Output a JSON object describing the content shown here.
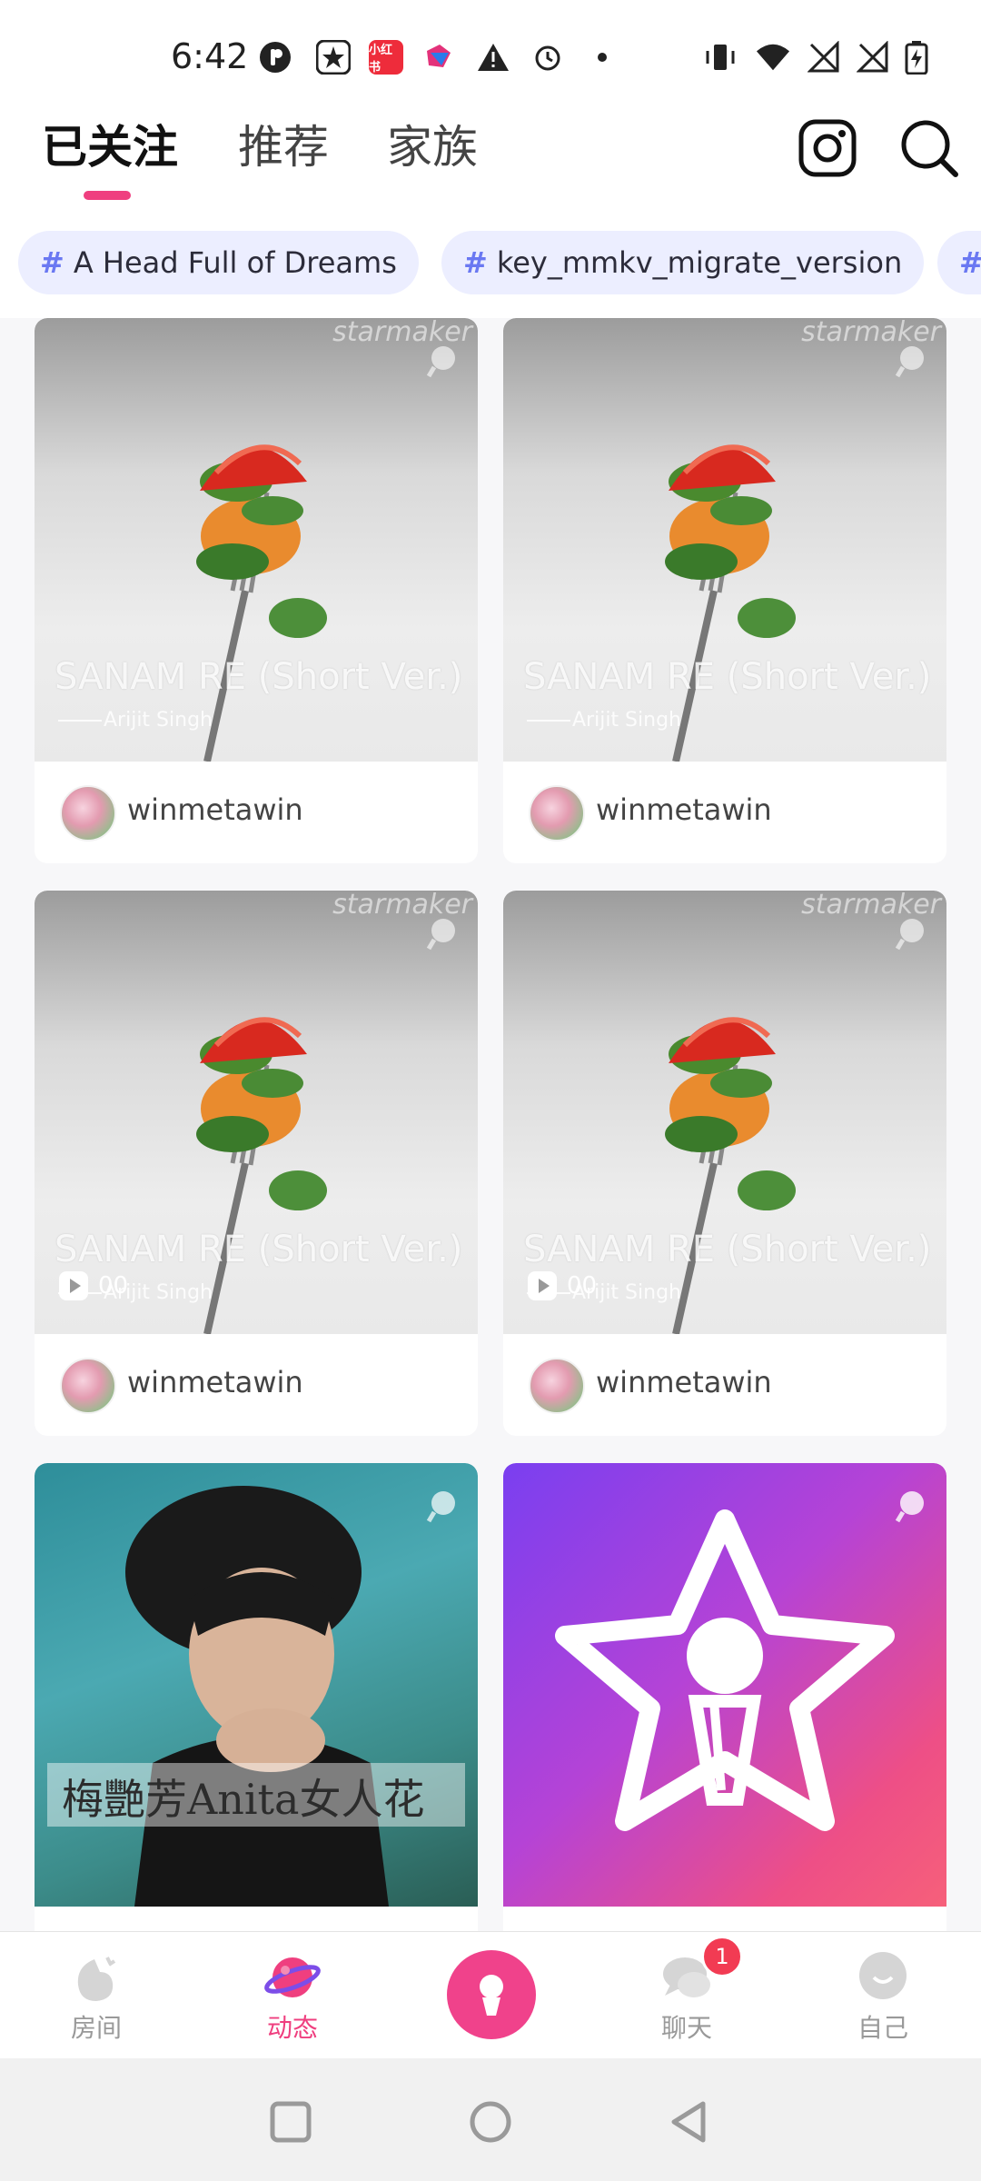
{
  "status_bar": {
    "time": "6:42",
    "left_icons": [
      "p-app-icon",
      "star-app-icon",
      "xiaohongshu-app-icon",
      "bilibili-app-icon",
      "warning-icon",
      "alarm-icon",
      "dot-icon"
    ],
    "xiaohongshu_label": "小红书",
    "right_icons": [
      "vibrate-icon",
      "wifi-icon",
      "no-signal-icon",
      "no-signal-icon",
      "battery-charging-icon"
    ]
  },
  "top_nav": {
    "tabs": [
      {
        "label": "已关注",
        "active": true
      },
      {
        "label": "推荐",
        "active": false
      },
      {
        "label": "家族",
        "active": false
      }
    ],
    "actions": [
      "instagram-icon",
      "search-icon"
    ]
  },
  "hashtags": [
    {
      "label": "A Head Full of Dreams"
    },
    {
      "label": "key_mmkv_migrate_version"
    },
    {
      "label": ""
    }
  ],
  "feed": {
    "watermark": "starmaker",
    "cards": [
      {
        "cover": "pasta",
        "song": "SANAM RE (Short Ver.)",
        "artist": "Arijit Singh",
        "user": "winmetawin",
        "play_count": ""
      },
      {
        "cover": "pasta",
        "song": "SANAM RE (Short Ver.)",
        "artist": "Arijit Singh",
        "user": "winmetawin",
        "play_count": ""
      },
      {
        "cover": "pasta",
        "song": "SANAM RE (Short Ver.)",
        "artist": "Arijit Singh",
        "user": "winmetawin",
        "play_count": "00"
      },
      {
        "cover": "pasta",
        "song": "SANAM RE (Short Ver.)",
        "artist": "Arijit Singh",
        "user": "winmetawin",
        "play_count": "00"
      },
      {
        "cover": "album-anita",
        "album_text": "梅艷芳Anita女人花",
        "user": ""
      },
      {
        "cover": "starmaker-logo",
        "user": ""
      }
    ]
  },
  "bottom_nav": {
    "items": [
      {
        "label": "房间",
        "icon": "room-icon",
        "active": false
      },
      {
        "label": "动态",
        "icon": "planet-icon",
        "active": true
      },
      {
        "label": "",
        "icon": "microphone-icon",
        "active": false
      },
      {
        "label": "聊天",
        "icon": "chat-icon",
        "active": false,
        "badge": "1"
      },
      {
        "label": "自己",
        "icon": "profile-icon",
        "active": false
      }
    ]
  },
  "system_nav": [
    "recents-button",
    "home-button",
    "back-button"
  ],
  "colors": {
    "accent": "#ef3f7f",
    "chip_bg": "#eceeff",
    "hash": "#6a78f2"
  }
}
